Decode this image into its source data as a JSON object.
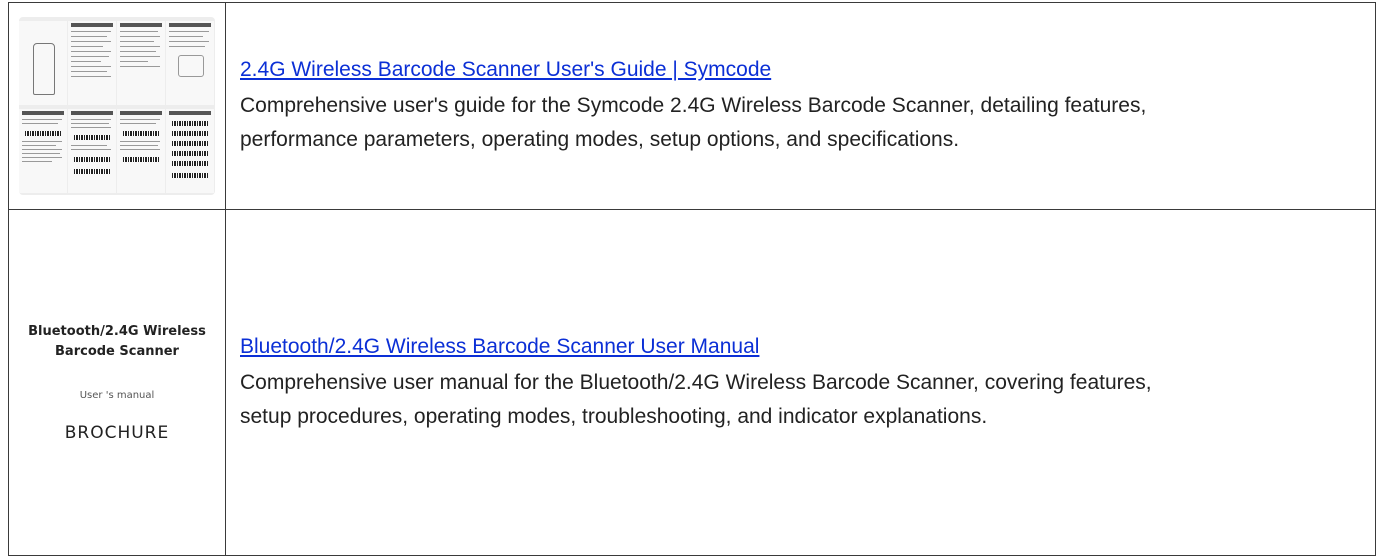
{
  "results": [
    {
      "title": "2.4G Wireless Barcode Scanner User's Guide | Symcode",
      "description_line1": "Comprehensive user's guide for the Symcode 2.4G Wireless Barcode Scanner, detailing features,",
      "description_line2": "performance parameters, operating modes, setup options, and specifications."
    },
    {
      "title": "Bluetooth/2.4G Wireless Barcode Scanner User Manual",
      "description_line1": "Comprehensive user manual for the Bluetooth/2.4G Wireless Barcode Scanner, covering features,",
      "description_line2": "setup procedures, operating modes, troubleshooting, and indicator explanations.",
      "thumbnail": {
        "title_line1": "Bluetooth/2.4G Wireless",
        "title_line2": "Barcode Scanner",
        "subtitle": "User 's manual",
        "brand": "BROCHURE"
      }
    }
  ],
  "colors": {
    "link": "#0b2fd6",
    "text": "#222222",
    "border": "#3a3a3a"
  }
}
